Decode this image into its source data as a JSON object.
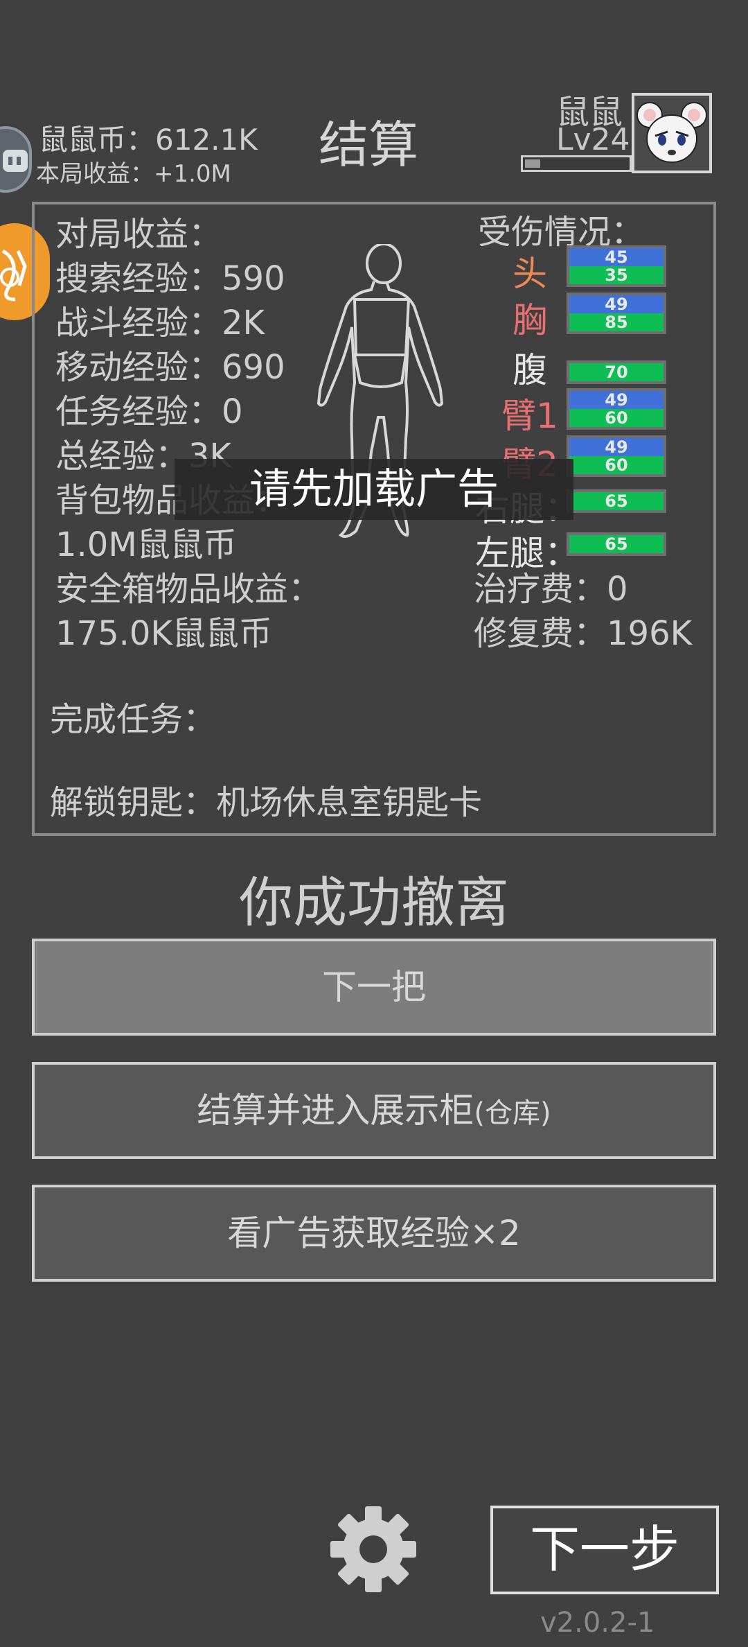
{
  "header": {
    "coin_label": "鼠鼠币：",
    "coin_value": "612.1K",
    "income_label": "本局收益：",
    "income_value": "+1.0M",
    "title": "结算",
    "player_name": "鼠鼠",
    "player_level": "Lv24",
    "xp_progress": 0.15
  },
  "stats": {
    "heading": "对局收益：",
    "rows": [
      {
        "label": "搜索经验：",
        "value": "590"
      },
      {
        "label": "战斗经验：",
        "value": "2K"
      },
      {
        "label": "移动经验：",
        "value": "690"
      },
      {
        "label": "任务经验：",
        "value": "0"
      },
      {
        "label": "总经验：",
        "value": "3K"
      }
    ],
    "backpack_label": "背包物品收益：",
    "backpack_value": "1.0M鼠鼠币",
    "safebox_label": "安全箱物品收益：",
    "safebox_value": "175.0K鼠鼠币",
    "quest_label": "完成任务：",
    "key_label": "解锁钥匙：",
    "key_value": "机场休息室钥匙卡"
  },
  "injury": {
    "title": "受伤情况：",
    "parts": [
      {
        "name": "头",
        "color": "#f08a55",
        "armor": "45",
        "hp": "35"
      },
      {
        "name": "胸",
        "color": "#e97070",
        "armor": "49",
        "hp": "85"
      },
      {
        "name": "腹",
        "color": "#e6e6e6",
        "armor": "",
        "hp": "70"
      },
      {
        "name": "臂1",
        "color": "#e97070",
        "armor": "49",
        "hp": "60"
      },
      {
        "name": "臂2",
        "color": "#e97070",
        "armor": "49",
        "hp": "60"
      },
      {
        "name": "右腿：",
        "color": "#e6e6e6",
        "armor": "",
        "hp": "65"
      },
      {
        "name": "左腿：",
        "color": "#e6e6e6",
        "armor": "",
        "hp": "65"
      }
    ],
    "treatment_label": "治疗费：",
    "treatment_value": "0",
    "repair_label": "修复费：",
    "repair_value": "196K"
  },
  "toast": "请先加载广告",
  "result_text": "你成功撤离",
  "buttons": {
    "next_round": "下一把",
    "settle_main": "结算并进入展示柜",
    "settle_small": "(仓库)",
    "ad_double": "看广告获取经验×2",
    "next_step": "下一步"
  },
  "version": "v2.0.2-1"
}
